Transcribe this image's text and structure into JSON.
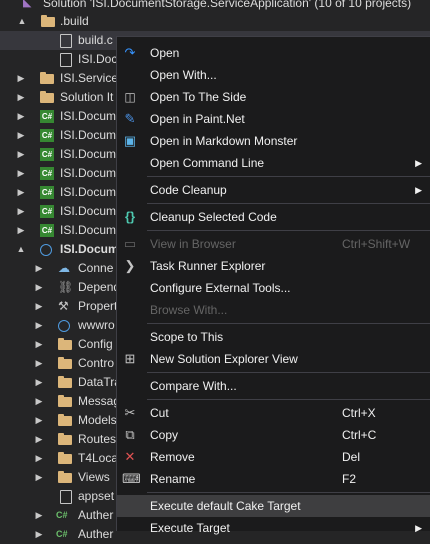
{
  "explorer": {
    "rows": [
      {
        "label": "Solution 'ISI.DocumentStorage.ServiceApplication' (10 of 10 projects)",
        "icon": "solution-icon",
        "expander": ""
      },
      {
        "label": ".build",
        "icon": "folder-icon",
        "expander": "▲"
      },
      {
        "label": "build.c",
        "icon": "file-icon",
        "expander": ""
      },
      {
        "label": "ISI.Docu",
        "icon": "file-icon",
        "expander": ""
      },
      {
        "label": "ISI.Services",
        "icon": "folder-icon",
        "expander": "▶"
      },
      {
        "label": "Solution It",
        "icon": "folder-icon",
        "expander": "▶"
      },
      {
        "label": "ISI.Docum",
        "icon": "csproj-icon",
        "expander": "▶"
      },
      {
        "label": "ISI.Docum",
        "icon": "csproj-icon",
        "expander": "▶"
      },
      {
        "label": "ISI.Docum",
        "icon": "csproj-icon",
        "expander": "▶"
      },
      {
        "label": "ISI.Docum",
        "icon": "csproj-icon",
        "expander": "▶"
      },
      {
        "label": "ISI.Docum",
        "icon": "csproj-icon",
        "expander": "▶"
      },
      {
        "label": "ISI.Docum",
        "icon": "csproj-icon",
        "expander": "▶"
      },
      {
        "label": "ISI.Docum",
        "icon": "csproj-icon",
        "expander": "▶"
      },
      {
        "label": "ISI.Docum",
        "icon": "web-project-icon",
        "expander": "▲"
      },
      {
        "label": "Conne",
        "icon": "connected-services-icon",
        "expander": "▶"
      },
      {
        "label": "Depend",
        "icon": "dependencies-icon",
        "expander": "▶"
      },
      {
        "label": "Propert",
        "icon": "properties-icon",
        "expander": "▶"
      },
      {
        "label": "wwwro",
        "icon": "globe-icon",
        "expander": "▶"
      },
      {
        "label": "Config",
        "icon": "folder-icon",
        "expander": "▶"
      },
      {
        "label": "Contro",
        "icon": "folder-icon",
        "expander": "▶"
      },
      {
        "label": "DataTra",
        "icon": "folder-icon",
        "expander": "▶"
      },
      {
        "label": "Messag",
        "icon": "folder-icon",
        "expander": "▶"
      },
      {
        "label": "Models",
        "icon": "folder-icon",
        "expander": "▶"
      },
      {
        "label": "Routes",
        "icon": "folder-icon",
        "expander": "▶"
      },
      {
        "label": "T4Loca",
        "icon": "folder-icon",
        "expander": "▶"
      },
      {
        "label": "Views",
        "icon": "folder-icon",
        "expander": "▶"
      },
      {
        "label": "appset",
        "icon": "settings-file-icon",
        "expander": ""
      },
      {
        "label": "Auther",
        "icon": "csharp-file-icon",
        "expander": "▶"
      },
      {
        "label": "Auther",
        "icon": "csharp-file-icon",
        "expander": "▶"
      }
    ]
  },
  "context_menu": {
    "items": [
      {
        "label": "Open",
        "icon": "open-arrow-icon",
        "shortcut": "",
        "submenu": false,
        "disabled": false
      },
      {
        "label": "Open With...",
        "icon": "",
        "shortcut": "",
        "submenu": false,
        "disabled": false
      },
      {
        "label": "Open To The Side",
        "icon": "split-view-icon",
        "shortcut": "",
        "submenu": false,
        "disabled": false
      },
      {
        "label": "Open in Paint.Net",
        "icon": "paint-icon",
        "shortcut": "",
        "submenu": false,
        "disabled": false
      },
      {
        "label": "Open in Markdown Monster",
        "icon": "markdown-monster-icon",
        "shortcut": "",
        "submenu": false,
        "disabled": false
      },
      {
        "label": "Open Command Line",
        "icon": "",
        "shortcut": "",
        "submenu": true,
        "disabled": false
      },
      {
        "label": "Code Cleanup",
        "icon": "",
        "shortcut": "",
        "submenu": true,
        "disabled": false
      },
      {
        "label": "Cleanup Selected Code",
        "icon": "braces-icon",
        "shortcut": "",
        "submenu": false,
        "disabled": false
      },
      {
        "label": "View in Browser",
        "icon": "browser-icon",
        "shortcut": "Ctrl+Shift+W",
        "submenu": false,
        "disabled": true
      },
      {
        "label": "Task Runner Explorer",
        "icon": "task-runner-icon",
        "shortcut": "",
        "submenu": false,
        "disabled": false
      },
      {
        "label": "Configure External Tools...",
        "icon": "",
        "shortcut": "",
        "submenu": false,
        "disabled": false
      },
      {
        "label": "Browse With...",
        "icon": "",
        "shortcut": "",
        "submenu": false,
        "disabled": true
      },
      {
        "label": "Scope to This",
        "icon": "",
        "shortcut": "",
        "submenu": false,
        "disabled": false
      },
      {
        "label": "New Solution Explorer View",
        "icon": "new-view-icon",
        "shortcut": "",
        "submenu": false,
        "disabled": false
      },
      {
        "label": "Compare With...",
        "icon": "",
        "shortcut": "",
        "submenu": false,
        "disabled": false
      },
      {
        "label": "Cut",
        "icon": "scissors-icon",
        "shortcut": "Ctrl+X",
        "submenu": false,
        "disabled": false
      },
      {
        "label": "Copy",
        "icon": "copy-icon",
        "shortcut": "Ctrl+C",
        "submenu": false,
        "disabled": false
      },
      {
        "label": "Remove",
        "icon": "remove-x-icon",
        "shortcut": "Del",
        "submenu": false,
        "disabled": false
      },
      {
        "label": "Rename",
        "icon": "rename-icon",
        "shortcut": "F2",
        "submenu": false,
        "disabled": false
      },
      {
        "label": "Execute default Cake Target",
        "icon": "",
        "shortcut": "",
        "submenu": false,
        "disabled": false,
        "highlighted": true
      },
      {
        "label": "Execute Target",
        "icon": "",
        "shortcut": "",
        "submenu": true,
        "disabled": false
      }
    ]
  },
  "colors": {
    "accent": "#3e3e40",
    "folder": "#dcb67a",
    "csproj": "#368832",
    "remove": "#e05252"
  }
}
